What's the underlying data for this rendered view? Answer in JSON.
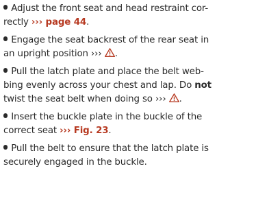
{
  "instructions": [
    {
      "line1_pre": "Adjust the front seat and head restraint cor-",
      "line2_pre": "rectly ",
      "line2_ref_chev": "›››",
      "line2_ref": " page 44",
      "line2_post": "."
    },
    {
      "line1_pre": "Engage the seat backrest of the rear seat in",
      "line2_pre": "an upright position ",
      "line2_chev": "›››",
      "line2_post": "."
    },
    {
      "line1_pre": "Pull the latch plate and place the belt web-",
      "line2_pre": "bing evenly across your chest and lap. Do ",
      "line2_bold": "not",
      "line3_pre": "twist the seat belt when doing so ",
      "line3_chev": "›››",
      "line3_post": "."
    },
    {
      "line1_pre": "Insert the buckle plate in the buckle of the",
      "line2_pre": "correct seat ",
      "line2_ref_chev": "›››",
      "line2_ref": " Fig. 23",
      "line2_post": "."
    },
    {
      "line1_pre": "Pull the belt to ensure that the latch plate is",
      "line2_pre": "securely engaged in the buckle."
    }
  ],
  "colors": {
    "text": "#2a2a2a",
    "reference": "#b73a22",
    "warning": "#b73a22"
  },
  "icons": {
    "bullet": "bullet-dot",
    "warning": "warning-triangle-icon"
  }
}
